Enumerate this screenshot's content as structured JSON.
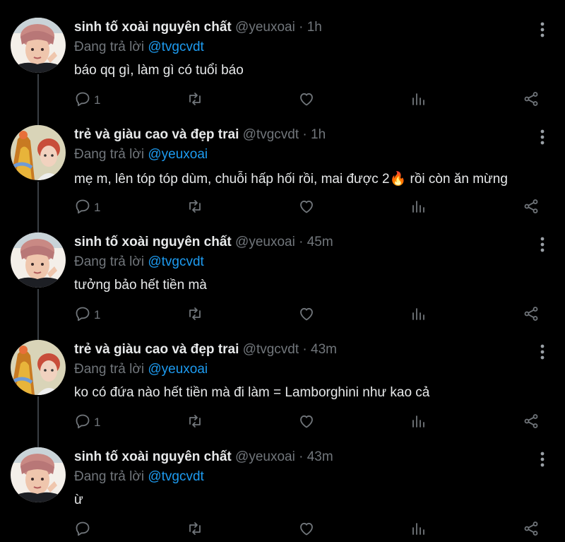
{
  "reply_prefix": "Đang trả lời",
  "tweets": [
    {
      "name": "sinh tố xoài nguyên chất",
      "handle": "@yeuxoai",
      "dot": "·",
      "time": "1h",
      "reply_to": "@tvgcvdt",
      "text": "báo qq gì, làm gì có tuổi báo",
      "replies": "1",
      "avatar": "user-a"
    },
    {
      "name": "trẻ và giàu cao và đẹp trai",
      "handle": "@tvgcvdt",
      "dot": "·",
      "time": "1h",
      "reply_to": "@yeuxoai",
      "text": "mẹ m, lên tóp tóp dùm, chuỗi hấp hối rồi, mai được 2🔥 rồi còn ăn mừng",
      "replies": "1",
      "avatar": "user-b"
    },
    {
      "name": "sinh tố xoài nguyên chất",
      "handle": "@yeuxoai",
      "dot": "·",
      "time": "45m",
      "reply_to": "@tvgcvdt",
      "text": "tưởng bảo hết tiền mà",
      "replies": "1",
      "avatar": "user-a"
    },
    {
      "name": "trẻ và giàu cao và đẹp trai",
      "handle": "@tvgcvdt",
      "dot": "·",
      "time": "43m",
      "reply_to": "@yeuxoai",
      "text": "ko có đứa nào hết tiền mà đi làm = Lamborghini như kao cả",
      "replies": "1",
      "avatar": "user-b"
    },
    {
      "name": "sinh tố xoài nguyên chất",
      "handle": "@yeuxoai",
      "dot": "·",
      "time": "43m",
      "reply_to": "@tvgcvdt",
      "text": "ừ",
      "replies": "",
      "avatar": "user-a"
    }
  ],
  "icons": {
    "reply": "reply-icon",
    "retweet": "retweet-icon",
    "like": "heart-icon",
    "views": "views-icon",
    "share": "share-icon",
    "more": "more-vertical-icon"
  },
  "colors": {
    "background": "#000000",
    "text": "#e7e9ea",
    "muted": "#71767b",
    "mention": "#1d9bf0",
    "thread": "#3a3f44"
  }
}
